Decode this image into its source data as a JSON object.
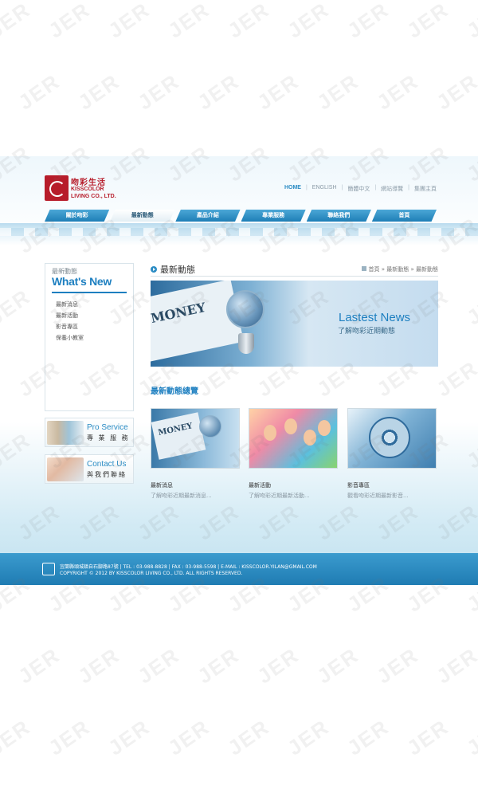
{
  "brand": {
    "name_cn": "吻彩生活",
    "name_en": "KISSCOLOR LIVING CO., LTD."
  },
  "toplinks": [
    {
      "label": "HOME",
      "active": true
    },
    {
      "label": "ENGLISH"
    },
    {
      "label": "簡體中文"
    },
    {
      "label": "網站導覽"
    },
    {
      "label": "集團主頁"
    }
  ],
  "nav": [
    {
      "label": "關於吻彩"
    },
    {
      "label": "最新動態",
      "current": true
    },
    {
      "label": "產品介紹"
    },
    {
      "label": "專業服務"
    },
    {
      "label": "聯絡我們"
    },
    {
      "label": "首頁"
    }
  ],
  "sidebar": {
    "label": "最新動態",
    "title": "What's New",
    "items": [
      "最新消息",
      "最新活動",
      "影音專區",
      "保養小教室"
    ]
  },
  "promos": [
    {
      "en": "Pro Service",
      "cn": "專 業 服 務"
    },
    {
      "en": "Contact Us",
      "cn": "與我們聯絡"
    }
  ],
  "main": {
    "title": "最新動態",
    "breadcrumb": "首頁 » 最新動態 » 最新動態",
    "banner_paper": "MONEY",
    "banner_title": "Lastest News",
    "banner_sub": "了解吻彩近期動態",
    "section_title": "最新動態總覽",
    "cards": [
      {
        "title": "最新消息",
        "desc": "了解吻彩近期最新消息...",
        "image": "newspaper-globe"
      },
      {
        "title": "最新活動",
        "desc": "了解吻彩近期最新活動...",
        "image": "party-crowd"
      },
      {
        "title": "影音專區",
        "desc": "觀看吻彩近期最新影音...",
        "image": "film-reel"
      }
    ]
  },
  "footer": {
    "line1": "宜蘭縣頭城鎮自石腳路87號 | TEL : 03-988-8828 | FAX : 03-988-5598 | E-MAIL : KISSCOLOR.YILAN@GMAIL.COM",
    "line2": "COPYRIGHT © 2012 BY KISSCOLOR LIVING CO., LTD. ALL RIGHTS RESERVED."
  },
  "colors": {
    "accent": "#1d7fc0",
    "brand_red": "#b71c2a",
    "footer": "#2a8bc1"
  },
  "watermark": "JER"
}
